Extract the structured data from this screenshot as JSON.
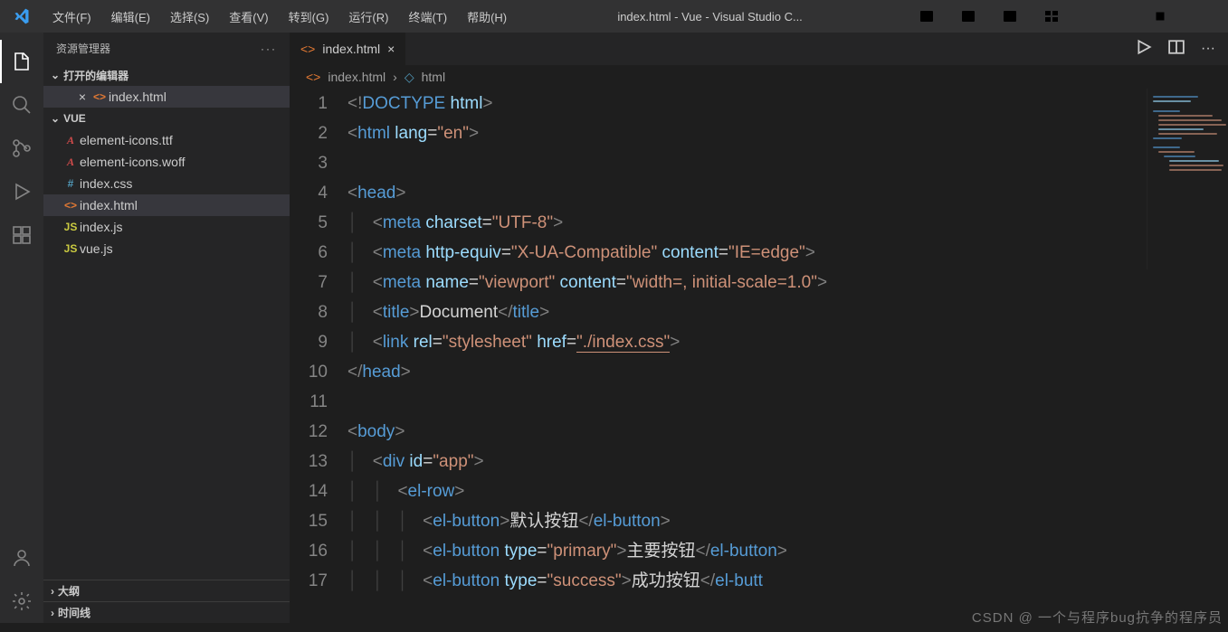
{
  "title": "index.html - Vue - Visual Studio C...",
  "menu": [
    "文件(F)",
    "编辑(E)",
    "选择(S)",
    "查看(V)",
    "转到(G)",
    "运行(R)",
    "终端(T)",
    "帮助(H)"
  ],
  "sidebar": {
    "title": "资源管理器",
    "openEditors": "打开的编辑器",
    "project": "VUE",
    "outline": "大纲",
    "timeline": "时间线",
    "openFile": "index.html",
    "files": [
      {
        "icon": "font",
        "name": "element-icons.ttf"
      },
      {
        "icon": "font",
        "name": "element-icons.woff"
      },
      {
        "icon": "css",
        "name": "index.css"
      },
      {
        "icon": "html",
        "name": "index.html",
        "active": true
      },
      {
        "icon": "js",
        "name": "index.js"
      },
      {
        "icon": "js",
        "name": "vue.js"
      }
    ]
  },
  "tab": {
    "name": "index.html"
  },
  "breadcrumb": {
    "file": "index.html",
    "node": "html"
  },
  "lineNumbers": [
    "1",
    "2",
    "3",
    "4",
    "5",
    "6",
    "7",
    "8",
    "9",
    "10",
    "11",
    "12",
    "13",
    "14",
    "15",
    "16",
    "17"
  ],
  "watermark": "CSDN @ 一个与程序bug抗争的程序员"
}
